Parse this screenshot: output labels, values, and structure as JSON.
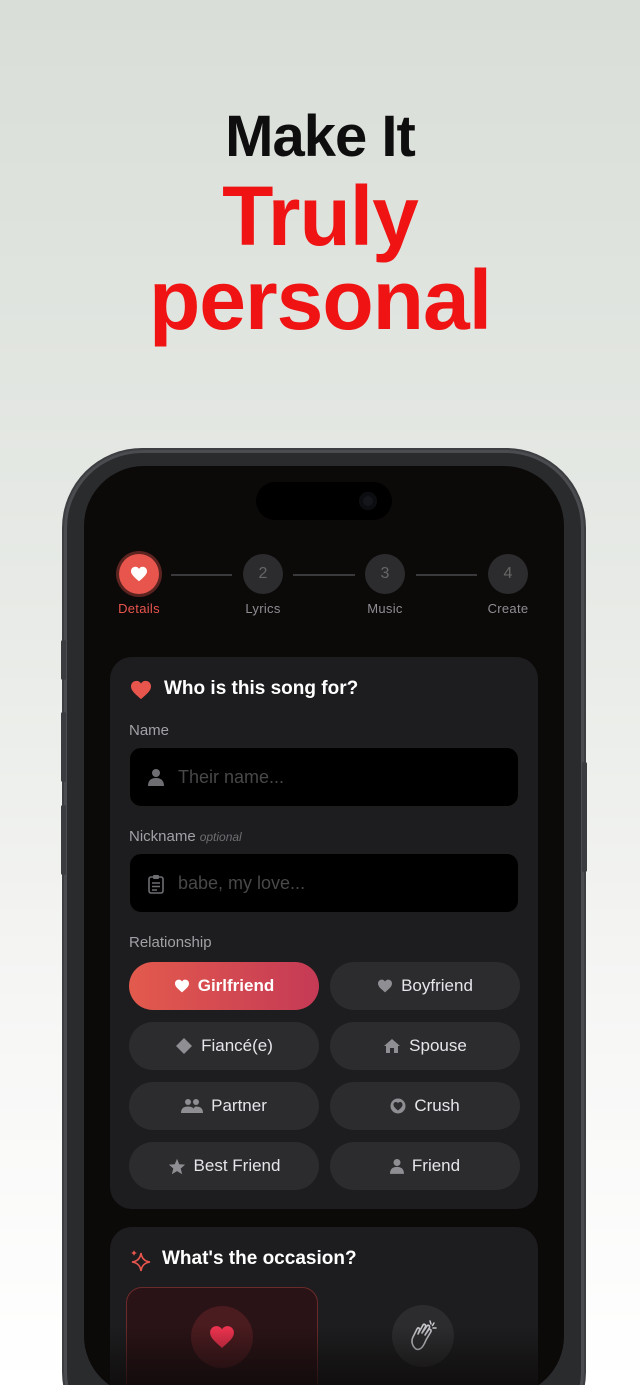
{
  "hero": {
    "line1": "Make It",
    "line2": "Truly",
    "line3": "personal"
  },
  "stepper": {
    "steps": [
      {
        "number": "",
        "icon": "heart-icon",
        "label": "Details",
        "active": true
      },
      {
        "number": "2",
        "label": "Lyrics",
        "active": false
      },
      {
        "number": "3",
        "label": "Music",
        "active": false
      },
      {
        "number": "4",
        "label": "Create",
        "active": false
      }
    ]
  },
  "details_card": {
    "title": "Who is this song for?",
    "name_label": "Name",
    "name_placeholder": "Their name...",
    "nickname_label": "Nickname",
    "nickname_optional": "optional",
    "nickname_placeholder": "babe, my love...",
    "relationship_label": "Relationship",
    "relationships": [
      {
        "label": "Girlfriend",
        "icon": "heart-icon",
        "selected": true
      },
      {
        "label": "Boyfriend",
        "icon": "heart-icon",
        "selected": false
      },
      {
        "label": "Fiancé(e)",
        "icon": "diamond-icon",
        "selected": false
      },
      {
        "label": "Spouse",
        "icon": "house-icon",
        "selected": false
      },
      {
        "label": "Partner",
        "icon": "people-icon",
        "selected": false
      },
      {
        "label": "Crush",
        "icon": "heart-circle-icon",
        "selected": false
      },
      {
        "label": "Best Friend",
        "icon": "star-icon",
        "selected": false
      },
      {
        "label": "Friend",
        "icon": "person-icon",
        "selected": false
      }
    ]
  },
  "occasion_card": {
    "title": "What's the occasion?"
  },
  "colors": {
    "accent": "#e8554d",
    "hero_red": "#f01313",
    "card_bg": "#1d1d1f",
    "chip_bg": "#2c2c2e"
  }
}
